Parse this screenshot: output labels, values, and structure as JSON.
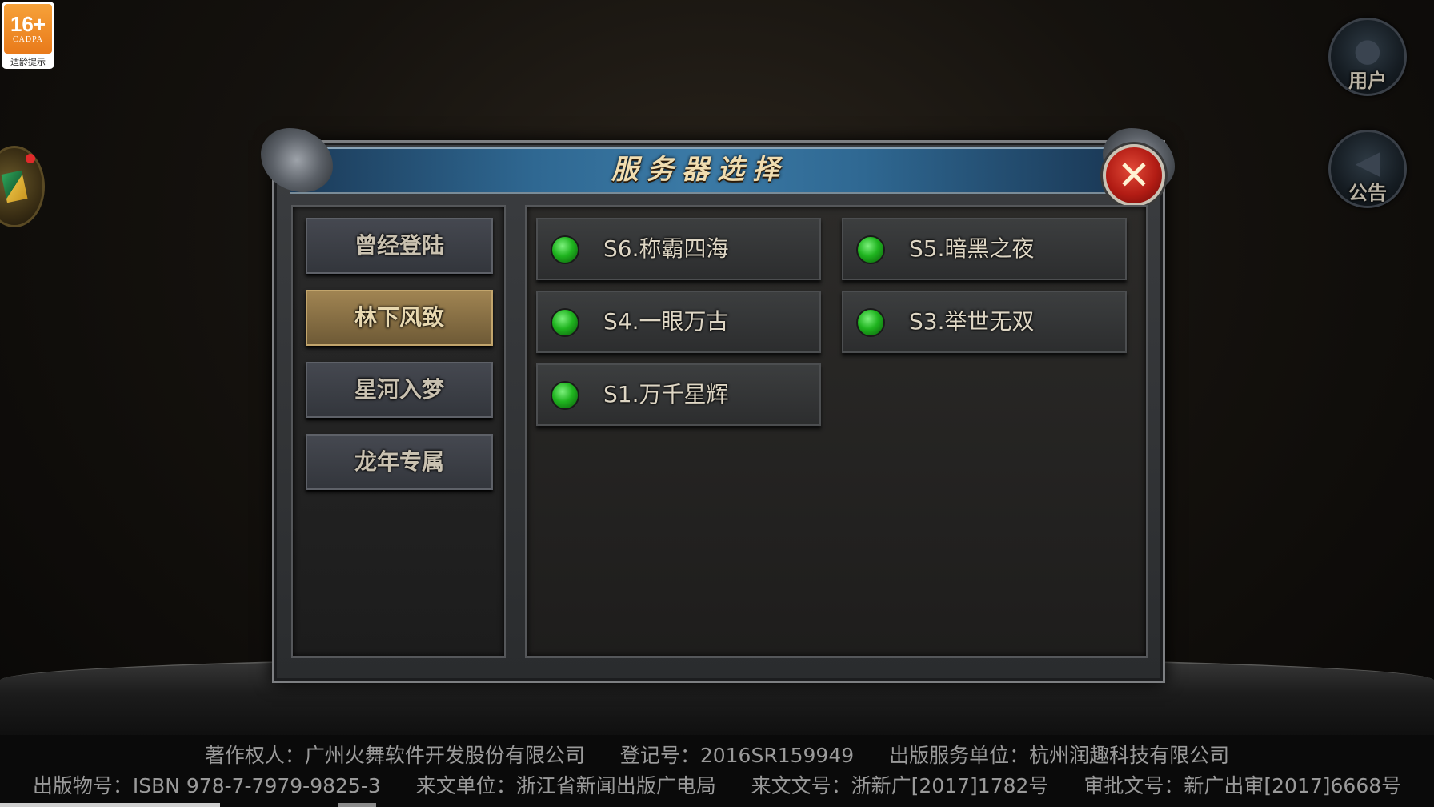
{
  "age_badge": {
    "rating": "16+",
    "org": "CADPA",
    "tip": "适龄提示"
  },
  "top_right": {
    "user_label": "用户",
    "notice_label": "公告"
  },
  "dialog": {
    "title": "服务器选择",
    "categories": [
      {
        "label": "曾经登陆",
        "active": false
      },
      {
        "label": "林下风致",
        "active": true
      },
      {
        "label": "星河入梦",
        "active": false
      },
      {
        "label": "龙年专属",
        "active": false
      }
    ],
    "servers": [
      {
        "name": "S6.称霸四海",
        "status": "green"
      },
      {
        "name": "S5.暗黑之夜",
        "status": "green"
      },
      {
        "name": "S4.一眼万古",
        "status": "green"
      },
      {
        "name": "S3.举世无双",
        "status": "green"
      },
      {
        "name": "S1.万千星辉",
        "status": "green"
      }
    ]
  },
  "footer": {
    "line1": [
      "著作权人：广州火舞软件开发股份有限公司",
      "登记号：2016SR159949",
      "出版服务单位：杭州润趣科技有限公司"
    ],
    "line2": [
      "出版物号：ISBN 978-7-7979-9825-3",
      "来文单位：浙江省新闻出版广电局",
      "来文文号：浙新广[2017]1782号",
      "审批文号：新广出审[2017]6668号"
    ]
  },
  "colors": {
    "accent_green": "#1fb41f",
    "close_red": "#b21c14",
    "active_gold": "#a08452"
  }
}
